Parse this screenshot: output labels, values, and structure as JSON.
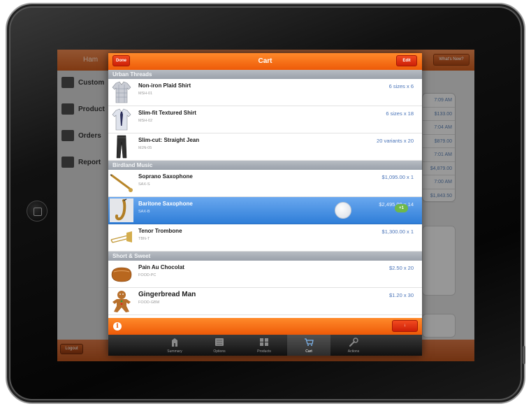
{
  "background_app": {
    "title": "Ham",
    "whats_new_label": "What's New?",
    "sidebar": [
      {
        "label": "Custom",
        "icon": "person-icon"
      },
      {
        "label": "Product",
        "icon": "box-icon"
      },
      {
        "label": "Orders",
        "icon": "book-icon"
      },
      {
        "label": "Report",
        "icon": "chart-icon"
      }
    ],
    "right_column": [
      "7:09 AM",
      "$133.00",
      "7:04 AM",
      "$879.00",
      "7:01 AM",
      "$4,879.00",
      "7:00 AM",
      "$1,843.50"
    ],
    "logout_label": "Logout"
  },
  "cart": {
    "title": "Cart",
    "done_label": "Done",
    "edit_label": "Edit",
    "footer_button_label": "↓",
    "info_icon": "i",
    "sections": [
      {
        "name": "Urban Threads",
        "items": [
          {
            "name": "Non-iron Plaid Shirt",
            "sku": "MSH-01",
            "detail": "6 sizes x 6",
            "thumb": "shirt-plaid"
          },
          {
            "name": "Slim-fit Textured Shirt",
            "sku": "MSH-02",
            "detail": "6 sizes x 18",
            "thumb": "shirt-tie"
          },
          {
            "name": "Slim-cut: Straight Jean",
            "sku": "MJN-05",
            "detail": "20 variants x 20",
            "thumb": "jeans"
          }
        ]
      },
      {
        "name": "Birdland Music",
        "items": [
          {
            "name": "Soprano Saxophone",
            "sku": "SAX-S",
            "detail": "$1,095.00 x 1",
            "thumb": "sax-soprano"
          },
          {
            "name": "Baritone Saxophone",
            "sku": "SAX-B",
            "detail": "$2,495.00 x 14",
            "thumb": "sax-baritone",
            "selected": true,
            "badge": "+1"
          },
          {
            "name": "Tenor Trombone",
            "sku": "TBN-T",
            "detail": "$1,300.00 x 1",
            "thumb": "trombone"
          }
        ]
      },
      {
        "name": "Short & Sweet",
        "items": [
          {
            "name": "Pain Au Chocolat",
            "sku": "FOOD-PC",
            "detail": "$2.50 x 20",
            "thumb": "croissant"
          },
          {
            "name": "Gingerbread Man",
            "sku": "FOOD-GBM",
            "detail": "$1.20 x 30",
            "thumb": "gingerbread"
          }
        ]
      }
    ],
    "tabs": [
      {
        "label": "Summary",
        "icon": "building-icon",
        "active": false
      },
      {
        "label": "Options",
        "icon": "list-icon",
        "active": false
      },
      {
        "label": "Products",
        "icon": "grid-icon",
        "active": false
      },
      {
        "label": "Cart",
        "icon": "cart-icon",
        "active": true
      },
      {
        "label": "Actions",
        "icon": "wrench-icon",
        "active": false
      }
    ]
  },
  "colors": {
    "accent_orange": "#ee5a08",
    "selection_blue": "#2f7ed8",
    "section_gray": "#9aa1aa",
    "detail_blue": "#4a74b8"
  }
}
